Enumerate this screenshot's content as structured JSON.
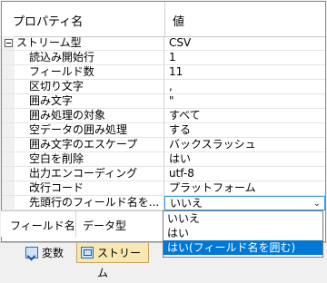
{
  "header": {
    "col_name": "プロパティ名",
    "col_value": "値"
  },
  "category": {
    "label": "ストリーム型",
    "value": "CSV"
  },
  "properties": [
    {
      "label": "読込み開始行",
      "value": "1"
    },
    {
      "label": "フィールド数",
      "value": "11"
    },
    {
      "label": "区切り文字",
      "value": ","
    },
    {
      "label": "囲み文字",
      "value": "\""
    },
    {
      "label": "囲み処理の対象",
      "value": "すべて"
    },
    {
      "label": "空データの囲み処理",
      "value": "する"
    },
    {
      "label": "囲み文字のエスケープ",
      "value": "バックスラッシュ"
    },
    {
      "label": "空白を削除",
      "value": "はい"
    },
    {
      "label": "出力エンコーディング",
      "value": "utf-8"
    },
    {
      "label": "改行コード",
      "value": "プラットフォーム"
    },
    {
      "label": "先頭行のフィールド名を...",
      "value": "いいえ"
    }
  ],
  "dropdown_options": [
    "いいえ",
    "はい",
    "はい(フィールド名を囲む)"
  ],
  "subgrid": {
    "col1": "フィールド名",
    "col2": "データ型"
  },
  "tabs": {
    "variables": "変数",
    "stream": "ストリーム"
  }
}
